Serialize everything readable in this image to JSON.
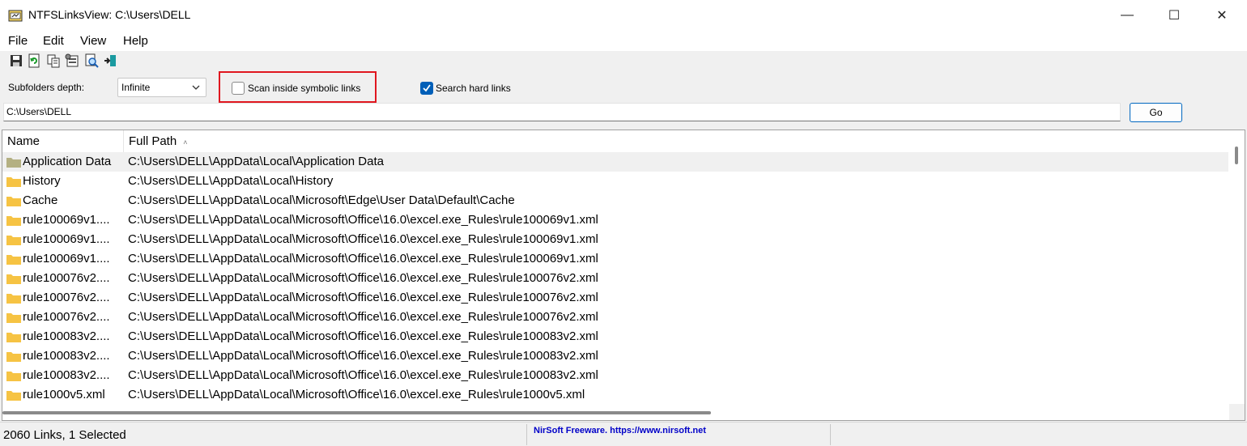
{
  "window": {
    "title": "NTFSLinksView:  C:\\Users\\DELL",
    "minimize_glyph": "—",
    "maximize_glyph": "☐",
    "close_glyph": "✕"
  },
  "menu": [
    "File",
    "Edit",
    "View",
    "Help"
  ],
  "toolbar": {
    "icons": [
      "save-icon",
      "refresh-icon",
      "copy-icon",
      "properties-icon",
      "find-icon",
      "exit-icon"
    ]
  },
  "options": {
    "depth_label": "Subfolders depth:",
    "depth_value": "Infinite",
    "scan_symbolic_label": "Scan inside symbolic links",
    "scan_symbolic_checked": false,
    "search_hard_label": "Search hard links",
    "search_hard_checked": true
  },
  "path_bar": {
    "value": "C:\\Users\\DELL",
    "go_label": "Go"
  },
  "table": {
    "columns": [
      "Name",
      "Full Path"
    ],
    "sort_glyph": "˄",
    "rows": [
      {
        "name": "Application Data",
        "path": "C:\\Users\\DELL\\AppData\\Local\\Application Data",
        "selected": true
      },
      {
        "name": "History",
        "path": "C:\\Users\\DELL\\AppData\\Local\\History"
      },
      {
        "name": "Cache",
        "path": "C:\\Users\\DELL\\AppData\\Local\\Microsoft\\Edge\\User Data\\Default\\Cache"
      },
      {
        "name": "rule100069v1....",
        "path": "C:\\Users\\DELL\\AppData\\Local\\Microsoft\\Office\\16.0\\excel.exe_Rules\\rule100069v1.xml"
      },
      {
        "name": "rule100069v1....",
        "path": "C:\\Users\\DELL\\AppData\\Local\\Microsoft\\Office\\16.0\\excel.exe_Rules\\rule100069v1.xml"
      },
      {
        "name": "rule100069v1....",
        "path": "C:\\Users\\DELL\\AppData\\Local\\Microsoft\\Office\\16.0\\excel.exe_Rules\\rule100069v1.xml"
      },
      {
        "name": "rule100076v2....",
        "path": "C:\\Users\\DELL\\AppData\\Local\\Microsoft\\Office\\16.0\\excel.exe_Rules\\rule100076v2.xml"
      },
      {
        "name": "rule100076v2....",
        "path": "C:\\Users\\DELL\\AppData\\Local\\Microsoft\\Office\\16.0\\excel.exe_Rules\\rule100076v2.xml"
      },
      {
        "name": "rule100076v2....",
        "path": "C:\\Users\\DELL\\AppData\\Local\\Microsoft\\Office\\16.0\\excel.exe_Rules\\rule100076v2.xml"
      },
      {
        "name": "rule100083v2....",
        "path": "C:\\Users\\DELL\\AppData\\Local\\Microsoft\\Office\\16.0\\excel.exe_Rules\\rule100083v2.xml"
      },
      {
        "name": "rule100083v2....",
        "path": "C:\\Users\\DELL\\AppData\\Local\\Microsoft\\Office\\16.0\\excel.exe_Rules\\rule100083v2.xml"
      },
      {
        "name": "rule100083v2....",
        "path": "C:\\Users\\DELL\\AppData\\Local\\Microsoft\\Office\\16.0\\excel.exe_Rules\\rule100083v2.xml"
      },
      {
        "name": "rule1000v5.xml",
        "path": "C:\\Users\\DELL\\AppData\\Local\\Microsoft\\Office\\16.0\\excel.exe_Rules\\rule1000v5.xml"
      }
    ]
  },
  "status": {
    "summary": "2060 Links, 1 Selected",
    "credit": "NirSoft Freeware. https://www.nirsoft.net"
  },
  "colors": {
    "highlight_border": "#e0171f",
    "checkbox_checked": "#005fb8",
    "folder": "#f6c343",
    "folder_selected": "#b4b083",
    "credit_text": "#0000c8"
  }
}
